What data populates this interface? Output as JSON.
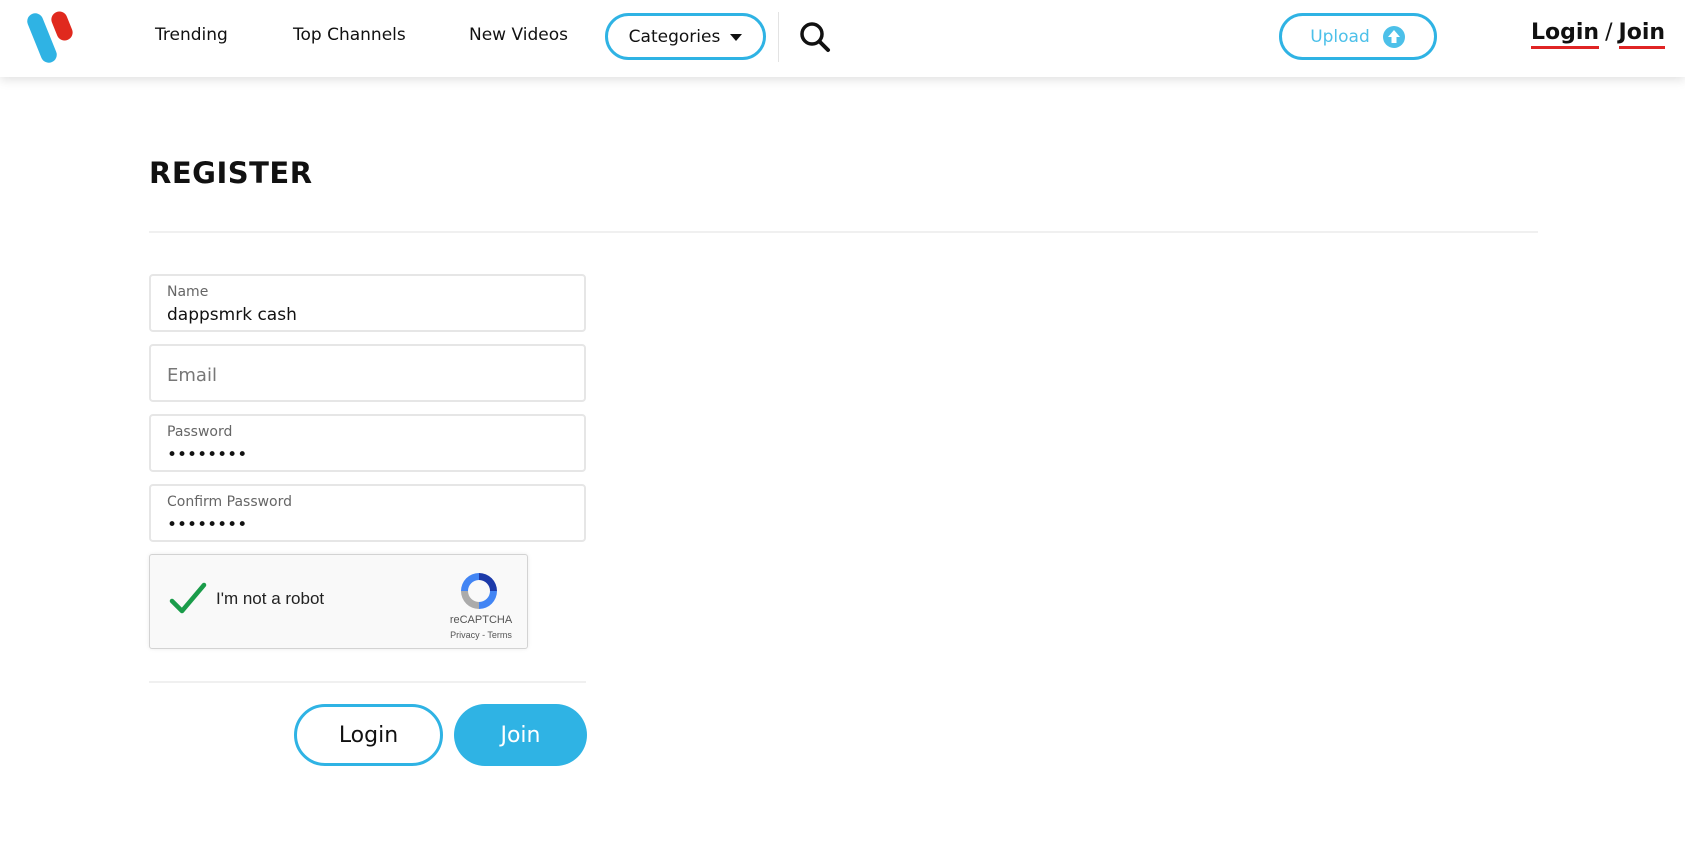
{
  "nav": {
    "trending": "Trending",
    "top_channels": "Top Channels",
    "new_videos": "New Videos",
    "categories": "Categories",
    "upload": "Upload",
    "login": "Login",
    "separator": "/",
    "join": "Join"
  },
  "page": {
    "title": "REGISTER"
  },
  "form": {
    "name_label": "Name",
    "name_value": "dappsmrk cash",
    "email_placeholder": "Email",
    "password_label": "Password",
    "password_value": "••••••••",
    "confirm_label": "Confirm Password",
    "confirm_value": "••••••••"
  },
  "captcha": {
    "text": "I'm not a robot",
    "brand": "reCAPTCHA",
    "links": "Privacy - Terms"
  },
  "buttons": {
    "login": "Login",
    "join": "Join"
  },
  "colors": {
    "accent": "#2fb3e4",
    "underline": "#e02424",
    "check": "#1a9c4a"
  },
  "icons": {
    "logo": "brand-logo",
    "search": "search-icon",
    "upload": "upload-cloud-icon",
    "caret": "caret-down-icon",
    "checkmark": "checkmark-icon",
    "recaptcha": "recaptcha-icon"
  }
}
